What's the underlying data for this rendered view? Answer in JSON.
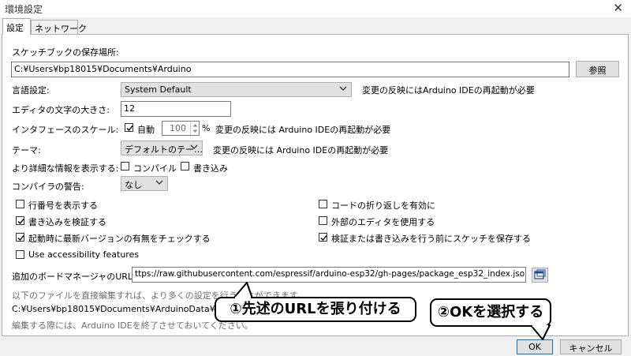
{
  "window": {
    "title": "環境設定",
    "close_glyph": "✕"
  },
  "tabs": [
    {
      "label": "設定"
    },
    {
      "label": "ネットワーク"
    }
  ],
  "sketchbook": {
    "label": "スケッチブックの保存場所:",
    "value": "C:¥Users¥bp18015¥Documents¥Arduino",
    "browse": "参照"
  },
  "language": {
    "label": "言語設定:",
    "value": "System Default",
    "note": "変更の反映にはArduino IDEの再起動が必要"
  },
  "editor_font": {
    "label": "エディタの文字の大きさ:",
    "value": "12"
  },
  "scale": {
    "label": "インタフェースのスケール:",
    "auto_label": "自動",
    "auto_checked": true,
    "value": "100",
    "unit": "%",
    "note": "変更の反映には Arduino IDEの再起動が必要"
  },
  "theme": {
    "label": "テーマ:",
    "value": "デフォルトのテー…",
    "note": "変更の反映には Arduino IDEの再起動が必要"
  },
  "verbose": {
    "label": "より詳細な情報を表示する:",
    "compile": "コンパイル",
    "upload": "書き込み"
  },
  "warnings": {
    "label": "コンパイラの警告:",
    "value": "なし"
  },
  "options": {
    "line_numbers": "行番号を表示する",
    "verify_upload": "書き込みを検証する",
    "check_updates": "起動時に最新バージョンの有無をチェックする",
    "accessibility": "Use accessibility features",
    "code_folding": "コードの折り返しを有効に",
    "external_editor": "外部のエディタを使用する",
    "save_before": "検証または書き込みを行う前にスケッチを保存する"
  },
  "boards_url": {
    "label": "追加のボードマネージャのURL:",
    "value": "ttps://raw.githubusercontent.com/espressif/arduino-esp32/gh-pages/package_esp32_index.json"
  },
  "notes": {
    "line1": "以下のファイルを直接編集すれば、より多くの設定を行うことができます。",
    "line2": "C:¥Users¥bp18015¥Documents¥ArduinoData¥preferences.txt",
    "line3": "編集する際には、Arduino IDEを終了させておいてください。"
  },
  "buttons": {
    "ok": "OK",
    "cancel": "キャンセル"
  },
  "callouts": {
    "one": "①先述のURLを張り付ける",
    "two": "②OKを選択する"
  }
}
